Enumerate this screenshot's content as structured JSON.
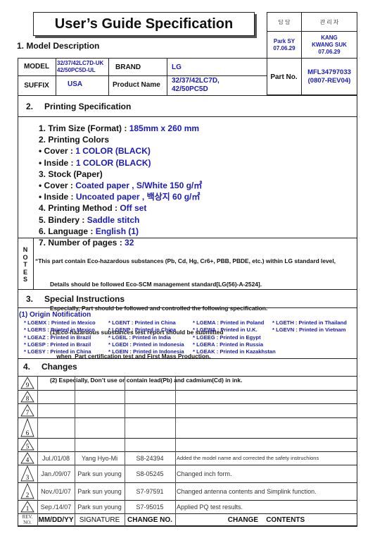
{
  "title": "User’s Guide Specification",
  "approval": {
    "headers": [
      "담 당",
      "관 리 자"
    ],
    "values": [
      [
        "Park SY",
        "07.06.29"
      ],
      [
        "KANG",
        "KWANG SUK",
        "07.06.29"
      ]
    ]
  },
  "section1": {
    "title": "1. Model Description"
  },
  "model_table": {
    "model_label": "MODEL",
    "model_value": [
      "32/37/42LC7D-UK",
      "42/50PC5D-UL"
    ],
    "brand_label": "BRAND",
    "brand_value": "LG",
    "suffix_label": "SUFFIX",
    "suffix_value": "USA",
    "product_name_label": "Product Name",
    "product_name_value": [
      "32/37/42LC7D,",
      "42/50PC5D"
    ],
    "part_no_label": "Part No.",
    "part_no_value": [
      "MFL34797033",
      "(0807-REV04)"
    ]
  },
  "section2": {
    "num": "2.",
    "title": "Printing Specification",
    "items": [
      {
        "label": "1. Trim Size (Format) : ",
        "value": "185mm x 260 mm"
      },
      {
        "label": "2. Printing Colors",
        "value": ""
      },
      {
        "label": "• Cover : ",
        "value": "1 COLOR (BLACK)"
      },
      {
        "label": "• Inside : ",
        "value": "1 COLOR (BLACK)"
      },
      {
        "label": "3. Stock (Paper)",
        "value": ""
      },
      {
        "label": "• Cover : ",
        "value": "Coated paper , S/White 150 g/㎡"
      },
      {
        "label": "• Inside : ",
        "value": "Uncoated paper , 백상지 60 g/㎡"
      },
      {
        "label": "4. Printing Method : ",
        "value": "Off set"
      },
      {
        "label": "5. Bindery  : ",
        "value": "Saddle stitch"
      },
      {
        "label": "6. Language : ",
        "value": "English (1)"
      },
      {
        "label": "7. Number of pages : ",
        "value": "32"
      }
    ]
  },
  "notes": {
    "label": [
      "N",
      "O",
      "T",
      "E",
      "S"
    ],
    "lines": [
      "“This part contain Eco-hazardous substances (Pb, Cd, Hg, Cr6+, PBB, PBDE, etc.) within LG standard level,",
      "         Details should be followed Eco-SCM management standard[LG(56)-A-2524].",
      "         Especially, Part should be followed and controlled the following specification.",
      "         (1)Eco-hazardous substances test report should be submitted",
      "             when  Part certification test and First Mass Production.",
      "         (2) Especially, Don’t use or contain lead(Pb) and cadmium(Cd) in ink."
    ]
  },
  "section3": {
    "num": "3.",
    "title": "Special Instructions",
    "origin_title": "(1) Origin Notification",
    "origin_columns": [
      [
        "* LGEMX : Printed in Mexico",
        "* LGERS : Printed in Mexico",
        "* LGEAZ : Printed in Brazil",
        "* LGESP : Printed in Brazil",
        "* LGESY : Printed in China"
      ],
      [
        "* LGENT : Printed in China",
        "* LGENP : Printed in China",
        "* LGEIL : Printed in India",
        "* LGEDI : Printed in Indonesia",
        "* LGEIN : Printed in Indonesia"
      ],
      [
        "* LGEMA : Printed in Poland",
        "* LGEWA : Printed in U.K.",
        "* LGEEG : Printed in Egypt",
        "* LGERA : Printed in Russia",
        "* LGEAK : Printed in Kazakhstan"
      ],
      [
        "* LGETH : Printed in Thailand",
        "* LGEVN : Printed in Vietnam"
      ]
    ]
  },
  "section4": {
    "num": "4.",
    "title": "Changes",
    "rows": [
      {
        "rev": "9",
        "date": "",
        "signature": "",
        "change_no": "",
        "contents": ""
      },
      {
        "rev": "8",
        "date": "",
        "signature": "",
        "change_no": "",
        "contents": ""
      },
      {
        "rev": "7",
        "date": "",
        "signature": "",
        "change_no": "",
        "contents": ""
      },
      {
        "rev": "6",
        "date": "",
        "signature": "",
        "change_no": "",
        "contents": ""
      },
      {
        "rev": "5",
        "date": "",
        "signature": "",
        "change_no": "",
        "contents": ""
      },
      {
        "rev": "4",
        "date": "Jul./01/08",
        "signature": "Yang Hyo-Mi",
        "change_no": "S8-24394",
        "contents": "Added the model name and corrected the safety instruchions"
      },
      {
        "rev": "3",
        "date": "Jan./09/07",
        "signature": "Park sun young",
        "change_no": "S8-05245",
        "contents": "Changed inch form."
      },
      {
        "rev": "2",
        "date": "Nov./01/07",
        "signature": "Park sun young",
        "change_no": "S7-97591",
        "contents": "Changed antenna contents and Simplink function."
      },
      {
        "rev": "1",
        "date": "Sep./14/07",
        "signature": "Park sun young",
        "change_no": "S7-95015",
        "contents": "Applied PQ test results."
      }
    ],
    "header": {
      "rev_no": [
        "REV.",
        "NO."
      ],
      "date": "MM/DD/YY",
      "signature": "SIGNATURE",
      "change_no": "CHANGE NO.",
      "contents": "CHANGE    CONTENTS"
    }
  }
}
